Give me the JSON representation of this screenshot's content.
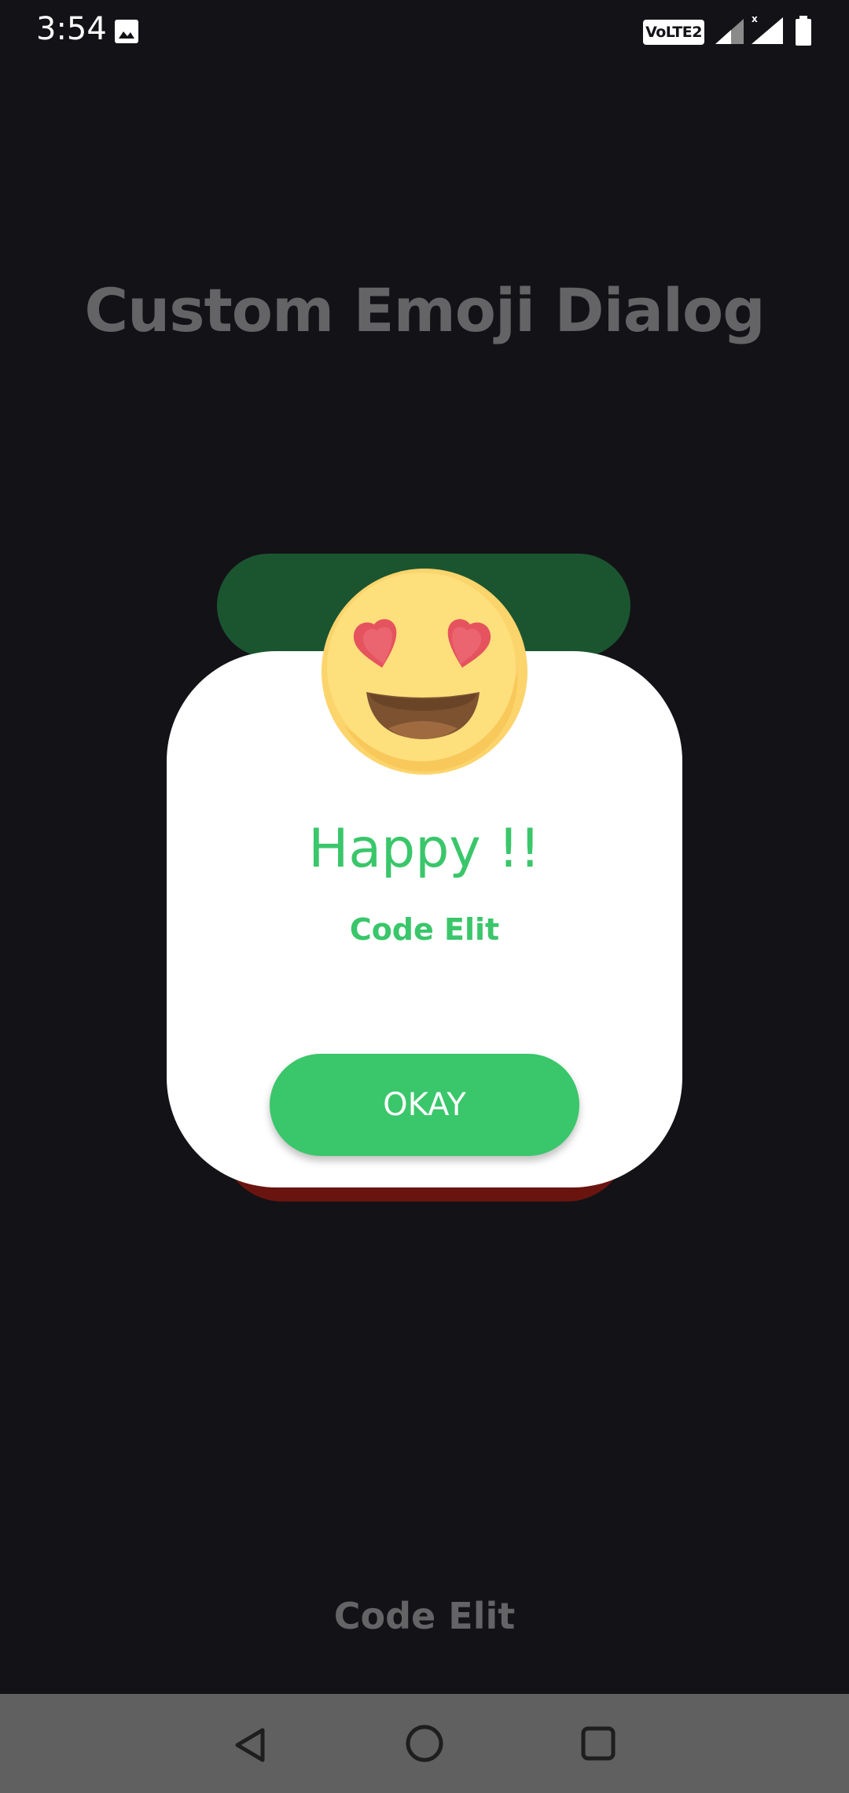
{
  "status_bar": {
    "time": "3:54",
    "volte_label": "VoLTE2",
    "icons": [
      "gallery-icon",
      "signal-icon",
      "signal-x-icon",
      "battery-icon"
    ]
  },
  "app": {
    "title": "Custom Emoji Dialog",
    "footer": "Code Elit"
  },
  "dialog": {
    "emoji": "heart-eyes-emoji",
    "title": "Happy !!",
    "subtitle": "Code Elit",
    "button_label": "OKAY",
    "colors": {
      "accent": "#3ac66a",
      "top_tab": "#1b5530",
      "bottom_shadow": "#6a1410",
      "card": "#ffffff"
    }
  },
  "nav_bar": {
    "buttons": [
      "back-icon",
      "home-icon",
      "recents-icon"
    ]
  },
  "colors": {
    "background": "#131217",
    "muted_text": "#646466",
    "nav_bar": "#606060"
  }
}
